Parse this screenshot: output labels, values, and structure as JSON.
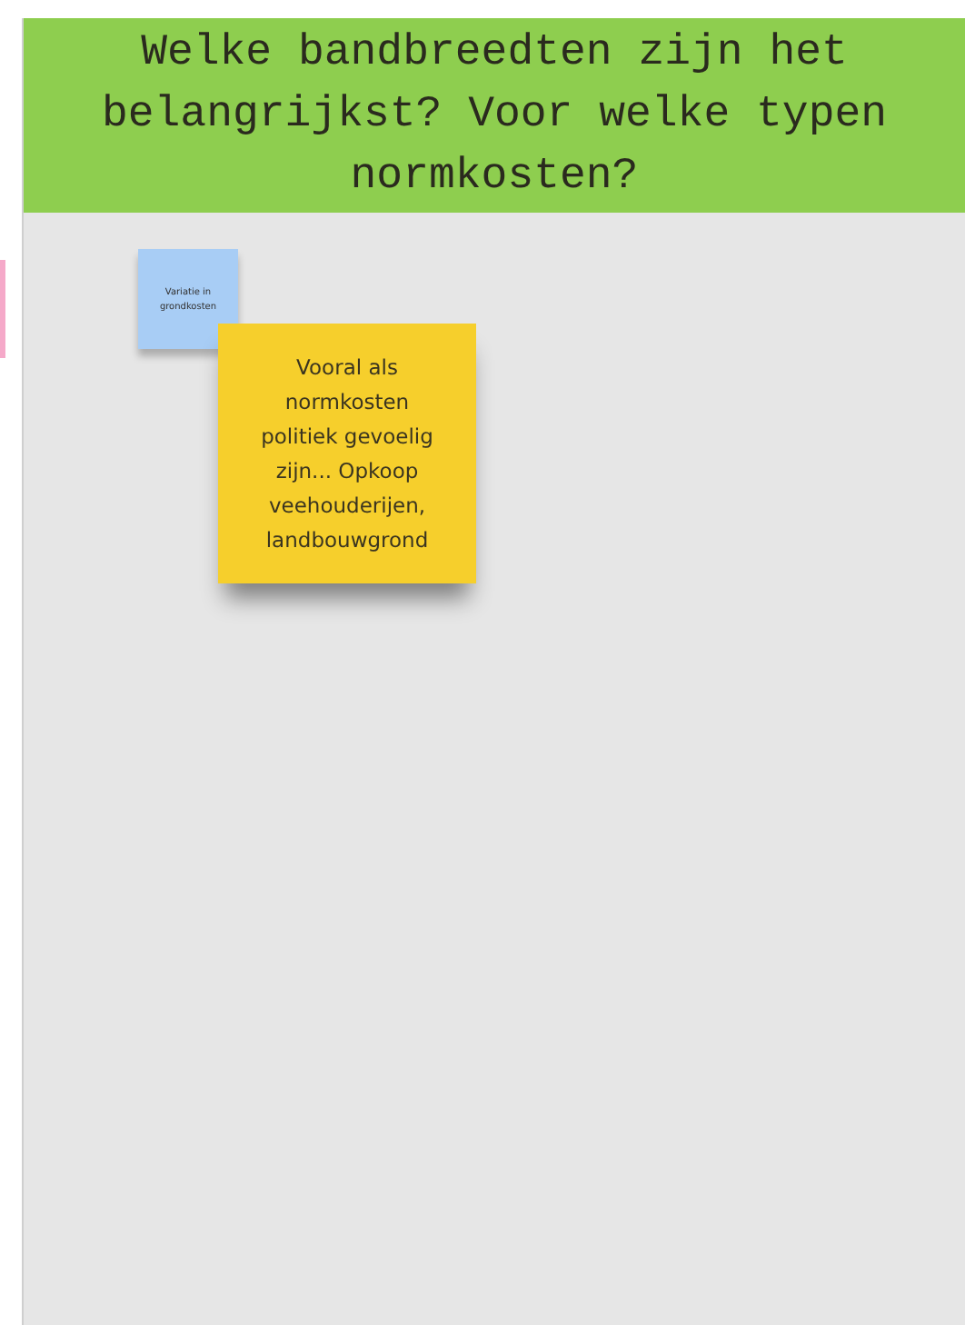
{
  "header": {
    "title": "Welke bandbreedten zijn het belangrijkst? Voor welke typen normkosten?"
  },
  "notes": [
    {
      "text": "Variatie in grondkosten",
      "color": "#a8cdf5",
      "kind": "small"
    },
    {
      "text": "Vooral als normkosten politiek gevoelig zijn... Opkoop veehouderijen, landbouwgrond",
      "color": "#f6cf2c",
      "kind": "large"
    }
  ],
  "offscreen_note": {
    "color": "#f5a9c9"
  }
}
